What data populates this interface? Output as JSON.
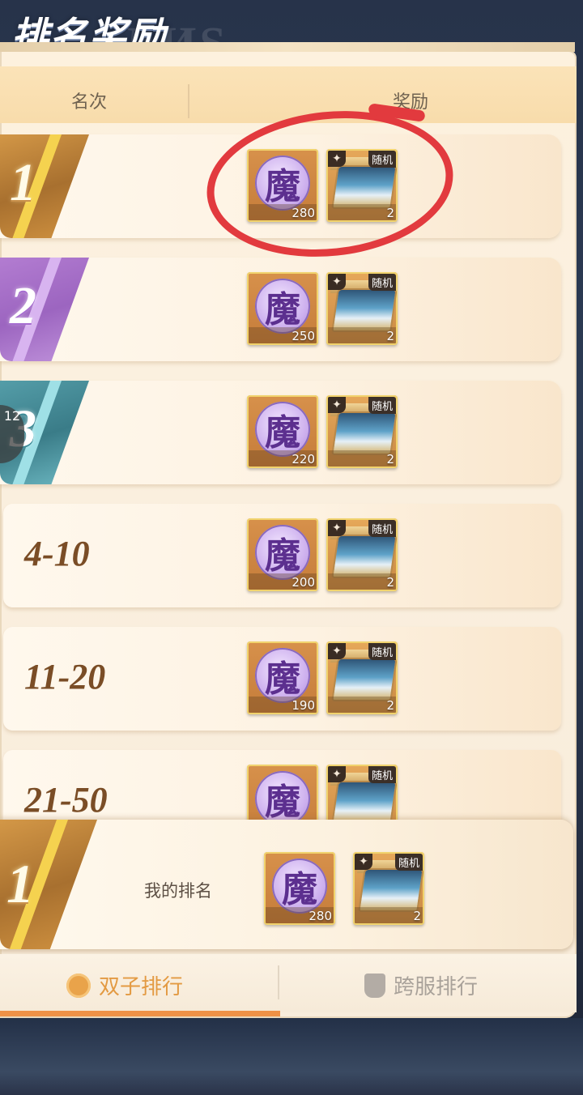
{
  "title": "排名奖励",
  "title_watermark": "ЛИS",
  "header": {
    "rank_col": "名次",
    "reward_col": "奖励"
  },
  "rows": [
    {
      "rank": "1",
      "coin_glyph": "魔",
      "coin_count": "280",
      "random_tag": "随机",
      "chest_count": "2"
    },
    {
      "rank": "2",
      "coin_glyph": "魔",
      "coin_count": "250",
      "random_tag": "随机",
      "chest_count": "2"
    },
    {
      "rank": "3",
      "coin_glyph": "魔",
      "coin_count": "220",
      "random_tag": "随机",
      "chest_count": "2"
    },
    {
      "rank": "4-10",
      "coin_glyph": "魔",
      "coin_count": "200",
      "random_tag": "随机",
      "chest_count": "2"
    },
    {
      "rank": "11-20",
      "coin_glyph": "魔",
      "coin_count": "190",
      "random_tag": "随机",
      "chest_count": "2"
    },
    {
      "rank": "21-50",
      "coin_glyph": "魔",
      "random_tag": "随机"
    }
  ],
  "side_bubble": {
    "count": "12"
  },
  "my_rank": {
    "rank": "1",
    "label": "我的排名",
    "coin_glyph": "魔",
    "coin_count": "280",
    "random_tag": "随机",
    "chest_count": "2"
  },
  "tabs": [
    {
      "label": "双子排行",
      "active": true,
      "icon": "twin-icon"
    },
    {
      "label": "跨服排行",
      "active": false,
      "icon": "banner-icon"
    }
  ],
  "colors": {
    "accent": "#ef9146",
    "highlight_circle": "#e23a3e",
    "gold": "#f5d24f"
  }
}
